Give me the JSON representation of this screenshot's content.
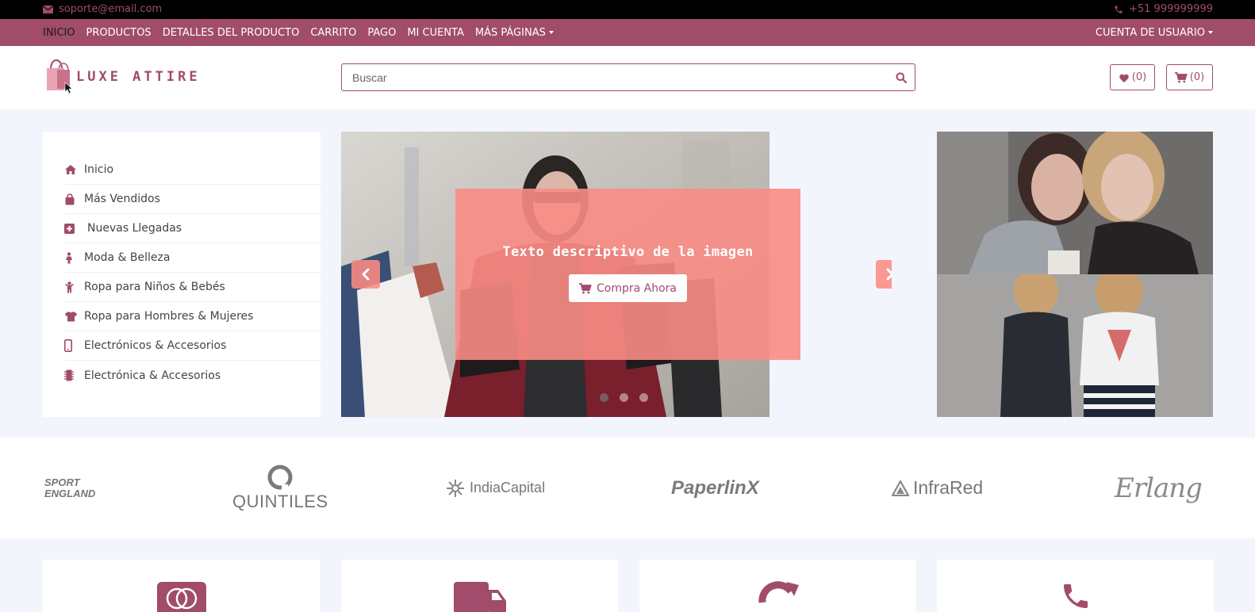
{
  "topbar": {
    "email": "soporte@email.com",
    "phone": "+51 999999999"
  },
  "nav": {
    "items": [
      "INICIO",
      "PRODUCTOS",
      "DETALLES DEL PRODUCTO",
      "CARRITO",
      "PAGO",
      "MI CUENTA",
      "MÁS PÁGINAS"
    ],
    "active_item": "INICIO",
    "account": "CUENTA DE USUARIO"
  },
  "header": {
    "logo_text": "LUXE ATTIRE",
    "search_placeholder": "Buscar",
    "wishlist_count": "(0)",
    "cart_count": "(0)"
  },
  "sidebar": {
    "items": [
      {
        "label": "Inicio",
        "icon": "home-icon"
      },
      {
        "label": "Más Vendidos",
        "icon": "shopping-bag-icon"
      },
      {
        "label": "Nuevas Llegadas",
        "icon": "plus-square-icon"
      },
      {
        "label": "Moda & Belleza",
        "icon": "female-icon"
      },
      {
        "label": "Ropa para Niños & Bebés",
        "icon": "child-icon"
      },
      {
        "label": "Ropa para Hombres & Mujeres",
        "icon": "tshirt-icon"
      },
      {
        "label": "Electrónicos & Accesorios",
        "icon": "mobile-icon"
      },
      {
        "label": "Electrónica & Accesorios",
        "icon": "microchip-icon"
      }
    ]
  },
  "carousel": {
    "caption": "Texto descriptivo de la imagen",
    "button_label": "Compra Ahora",
    "slide_count": 3,
    "active_slide": 1
  },
  "brands": {
    "sport_england_line1": "SPORT",
    "sport_england_line2": "ENGLAND",
    "quintiles": "QUINTILES",
    "indiacapital": "IndiaCapital",
    "paperlinx": "PaperlinX",
    "infrared": "InfraRed",
    "erlang": "Erlang"
  },
  "features": {
    "icons": [
      "credit-card-icon",
      "truck-icon",
      "refresh-icon",
      "phone-icon"
    ]
  },
  "colors": {
    "brand": "#a04c6a",
    "topbar": "#000000",
    "overlay": "#fa8c85",
    "page_background": "#f3f5fd"
  }
}
